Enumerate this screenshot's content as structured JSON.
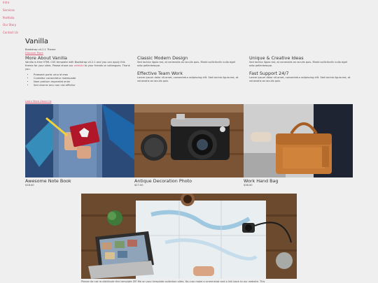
{
  "nav": [
    "Intro",
    "Services",
    "Portfolio",
    "Our Story",
    "Contact Us"
  ],
  "brand": "Vanilla",
  "tagline": "Bootstrap v4.2.1 Theme",
  "discover": "Discover More",
  "about": {
    "title": "More About Vanilla",
    "text_before": "Vanilla is free HTML CSS template with Bootstrap v4.2.1 and you can apply this theme for your sites. Please share our",
    "link": "website",
    "text_after": "to your friends or colleagues. Thank you.",
    "bullets": [
      "Praesent porta urna id eros",
      "Curabitur consectetur malesuada",
      "Nam pretium imperdiet enim",
      "Sed viverra arcu non nisi efficitur"
    ],
    "learn_more": "Learn More About Us"
  },
  "features": [
    {
      "title": "Classic Modern Design",
      "text": "Sed lacinia ligula est, at venenatis ex iaculis quis. Morbi sollicitudin nulla eget odio pellentesque."
    },
    {
      "title": "Unique & Creative Ideas",
      "text": "Sed lacinia ligula est, at venenatis ex iaculis quis. Morbi sollicitudin nulla eget odio pellentesque."
    },
    {
      "title": "Effective Team Work",
      "text": "Lorem ipsum dolor sit amet, consectetur adipiscing elit. Sed lacinia ligula est, at venenatis ex iaculis quis."
    },
    {
      "title": "Fast Support 24/7",
      "text": "Lorem ipsum dolor sit amet, consectetur adipiscing elit. Sed lacinia ligula est, at venenatis ex iaculis quis."
    }
  ],
  "products": [
    {
      "name": "Awesome Note Book",
      "price": "$18.00"
    },
    {
      "name": "Antique Decoration Photo",
      "price": "$27.00"
    },
    {
      "name": "Work Hand Bag",
      "price": "$36.00"
    }
  ],
  "caption": "Please do not re-distribute this template ZIP file on your template collection sites. You can make a screenshot and a link back to our website. This"
}
